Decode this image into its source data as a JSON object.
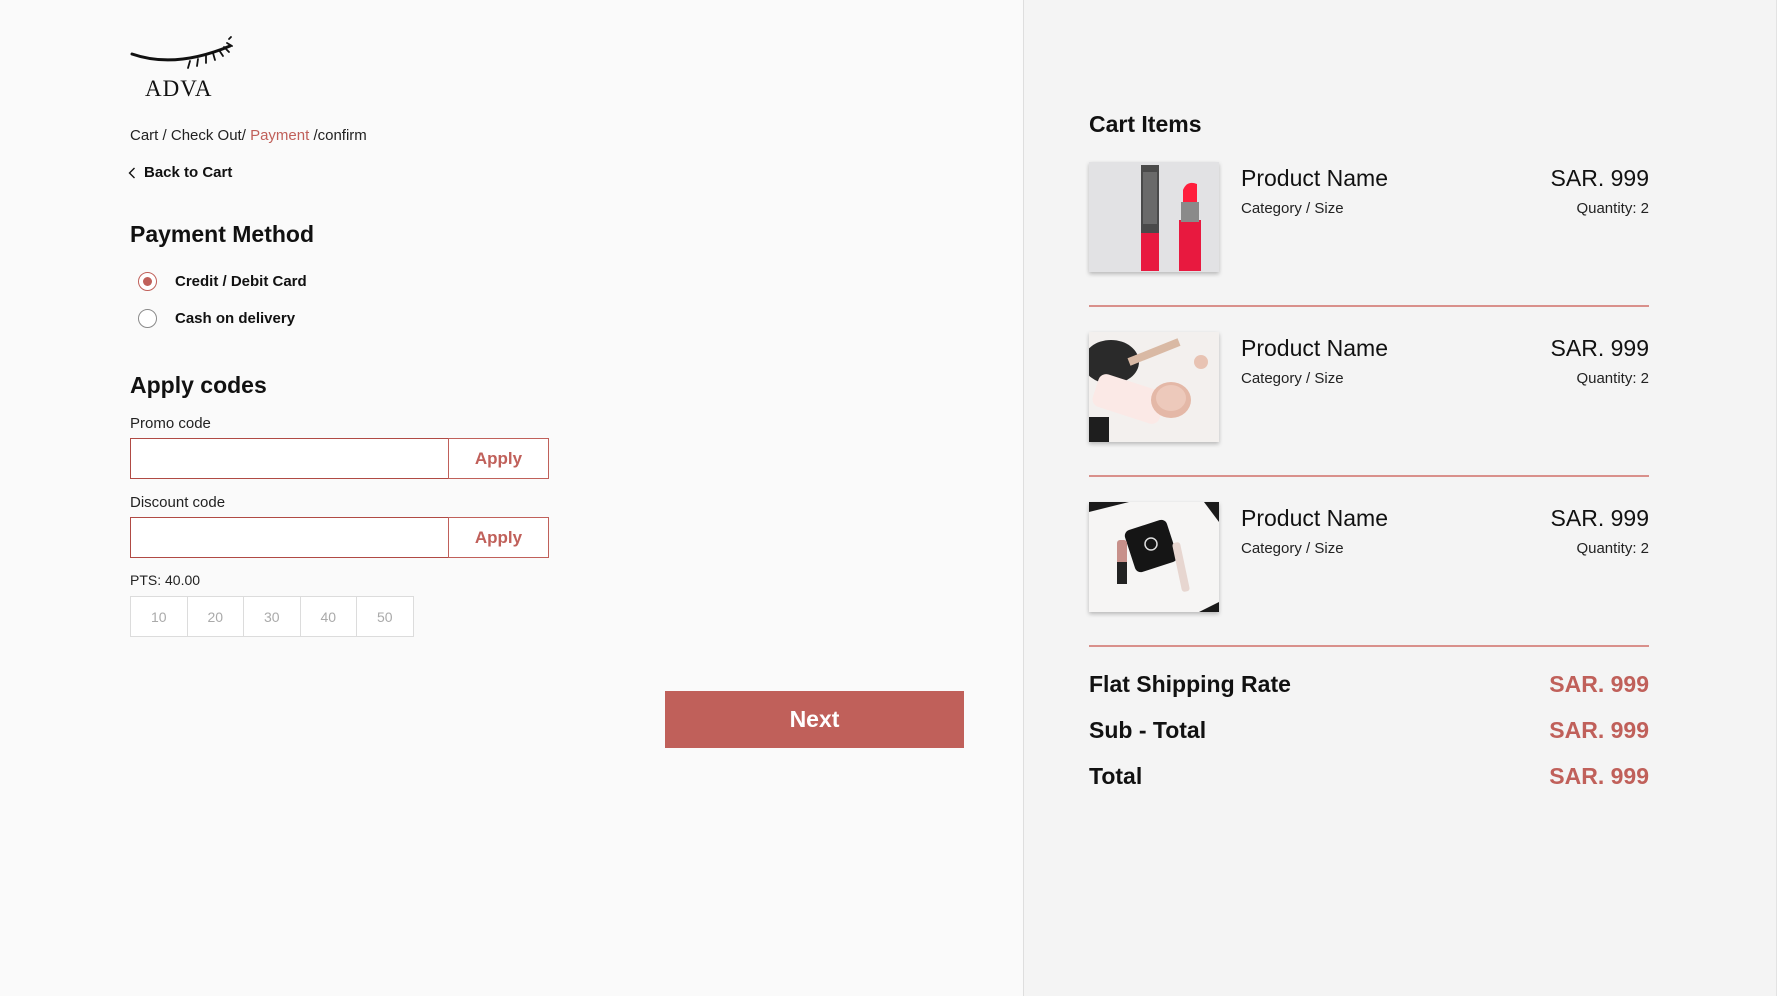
{
  "brand": {
    "name": "ADVA"
  },
  "breadcrumb": {
    "cart": "Cart",
    "checkout": "Check Out",
    "payment": "Payment",
    "confirm": "confirm",
    "sep": " / ",
    "sep2": "/ ",
    "sep3": " /"
  },
  "back": {
    "label": "Back to Cart"
  },
  "payment_method": {
    "title": "Payment Method",
    "options": [
      {
        "label": "Credit / Debit Card",
        "selected": true
      },
      {
        "label": "Cash on delivery",
        "selected": false
      }
    ]
  },
  "codes": {
    "title": "Apply codes",
    "promo_label": "Promo code",
    "promo_value": "",
    "discount_label": "Discount code",
    "discount_value": "",
    "apply_label": "Apply"
  },
  "points": {
    "label": "PTS: 40.00",
    "chips": [
      "10",
      "20",
      "30",
      "40",
      "50"
    ]
  },
  "next_label": "Next",
  "cart": {
    "title": "Cart Items",
    "items": [
      {
        "name": "Product Name",
        "category": "Category / Size",
        "price": "SAR. 999",
        "quantity": "Quantity: 2"
      },
      {
        "name": "Product Name",
        "category": "Category / Size",
        "price": "SAR. 999",
        "quantity": "Quantity: 2"
      },
      {
        "name": "Product Name",
        "category": "Category / Size",
        "price": "SAR. 999",
        "quantity": "Quantity: 2"
      }
    ]
  },
  "summary": {
    "shipping_label": "Flat Shipping Rate",
    "shipping_value": "SAR. 999",
    "subtotal_label": "Sub - Total",
    "subtotal_value": "SAR. 999",
    "total_label": "Total",
    "total_value": "SAR. 999"
  },
  "colors": {
    "accent": "#c0605a",
    "divider": "#d9908b"
  },
  "icons": {
    "back": "chevron-left-icon",
    "logo": "eyelash-logo-icon"
  }
}
